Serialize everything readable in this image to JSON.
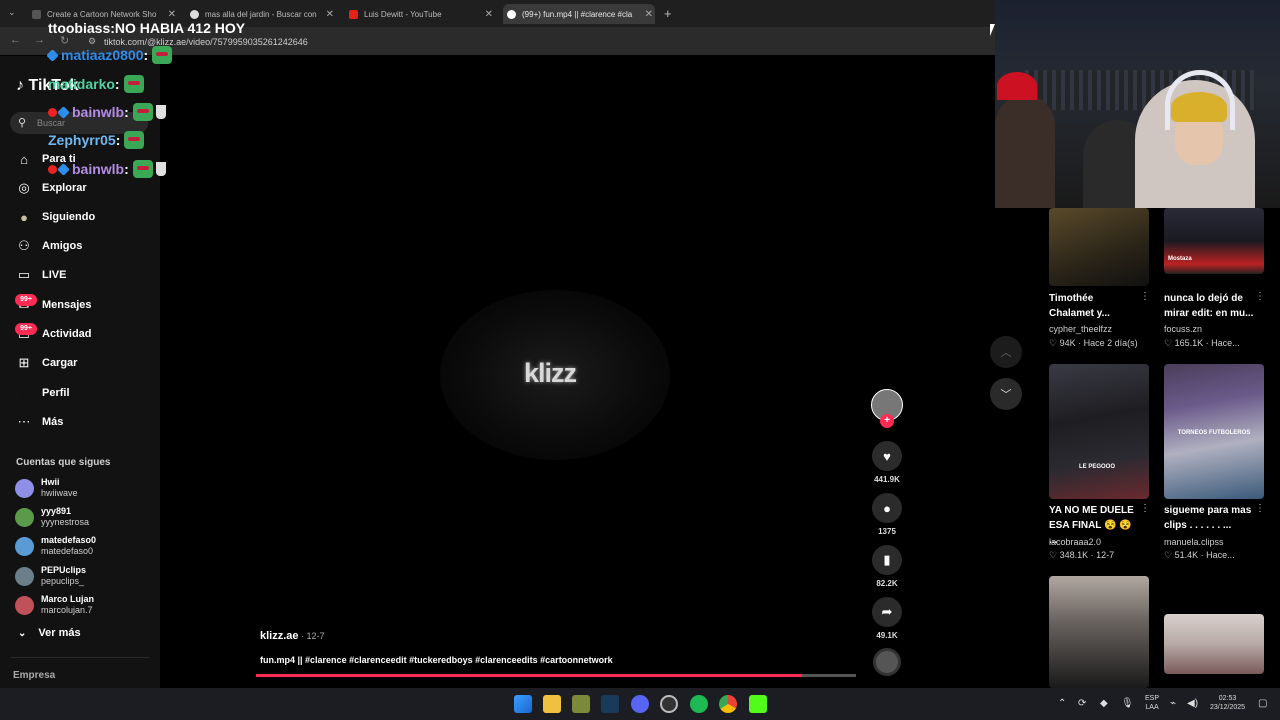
{
  "browser": {
    "tabs": [
      {
        "label": "Create a Cartoon Network Sho",
        "active": false
      },
      {
        "label": "mas alla del jardin - Buscar con",
        "active": false
      },
      {
        "label": "Luis Dewitt - YouTube",
        "active": false
      },
      {
        "label": "(99+) fun.mp4 || #clarence #cla",
        "active": true
      }
    ],
    "new_tab": "+",
    "url": "tiktok.com/@klizz.ae/video/7579959035261242646"
  },
  "sidebar": {
    "logo": "TikTok",
    "search_placeholder": "Buscar",
    "nav": [
      {
        "label": "Para ti",
        "icon": "home-icon",
        "glyph": "⌂"
      },
      {
        "label": "Explorar",
        "icon": "compass-icon",
        "glyph": "◎"
      },
      {
        "label": "Siguiendo",
        "icon": "following-avatar-icon",
        "glyph": "●"
      },
      {
        "label": "Amigos",
        "icon": "friends-icon",
        "glyph": "⚇"
      },
      {
        "label": "LIVE",
        "icon": "live-icon",
        "glyph": "▭"
      },
      {
        "label": "Mensajes",
        "icon": "messages-icon",
        "glyph": "✉",
        "badge": "99+"
      },
      {
        "label": "Actividad",
        "icon": "activity-icon",
        "glyph": "☐",
        "badge": "99+"
      },
      {
        "label": "Cargar",
        "icon": "upload-icon",
        "glyph": "⊞"
      },
      {
        "label": "Perfil",
        "icon": "profile-icon",
        "glyph": "●"
      },
      {
        "label": "Más",
        "icon": "more-icon",
        "glyph": "⋯"
      }
    ],
    "following_title": "Cuentas que sigues",
    "following": [
      {
        "name": "Hwii",
        "handle": "hwiiwave",
        "color": "#8f8fe8"
      },
      {
        "name": "yyy891",
        "handle": "yyynestrosa",
        "color": "#5a9a4a"
      },
      {
        "name": "matedefaso0",
        "handle": "matedefaso0",
        "color": "#5b9bd5"
      },
      {
        "name": "PEPUclips",
        "handle": "pepuclips_",
        "color": "#6a7f8a"
      },
      {
        "name": "Marco Lujan",
        "handle": "marcolujan.7",
        "color": "#c0505a"
      }
    ],
    "see_more": "Ver más",
    "footer": "Empresa"
  },
  "chat": [
    {
      "user": "ttoobiass",
      "color": "#ffffff",
      "text": "NO HABIA 412 HOY"
    },
    {
      "user": "matiaaz0800",
      "color": "#2c8dea",
      "text": ""
    },
    {
      "user": "matidarko",
      "color": "#4fd3a0",
      "text": ""
    },
    {
      "user": "bainwlb",
      "color": "#b48ce8",
      "text": ""
    },
    {
      "user": "Zephyrr05",
      "color": "#6fb7f0",
      "text": ""
    },
    {
      "user": "bainwlb",
      "color": "#b48ce8",
      "text": ""
    }
  ],
  "video": {
    "watermark": "klizz",
    "author": "klizz.ae",
    "date": "12-7",
    "description": "fun.mp4 || #clarence #clarenceedit #tuckeredboys #clarenceedits #cartoonnetwork",
    "progress": 0.91,
    "likes": "441.9K",
    "comments": "1375",
    "saves": "82.2K",
    "shares": "49.1K"
  },
  "feed": [
    {
      "title1": "Timothée",
      "title2": "Chalamet y...",
      "author": "cypher_theelfzz",
      "stats": "♡ 94K · Hace 2 día(s)",
      "thumb_text": ""
    },
    {
      "title1": "nunca lo dejó de",
      "title2": "mirar edit: en mu...",
      "author": "focuss.zn",
      "stats": "♡ 165.1K · Hace...",
      "thumb_text": "Mostaza"
    },
    {
      "title1": "YA NO ME DUELE",
      "title2": "ESA FINAL 😵 😵 ...",
      "author": "lacobraaa2.0",
      "stats": "♡ 348.1K · 12-7",
      "thumb_text": "LE PEGOOO"
    },
    {
      "title1": "sigueme para mas",
      "title2": "clips . . . . . . ...",
      "author": "manuela.clipss",
      "stats": "♡ 51.4K · Hace...",
      "thumb_text": "TORNEOS FUTBOLEROS"
    }
  ],
  "taskbar": {
    "lang1": "ESP",
    "lang2": "LAA",
    "time": "02:53",
    "date": "23/12/2025"
  }
}
